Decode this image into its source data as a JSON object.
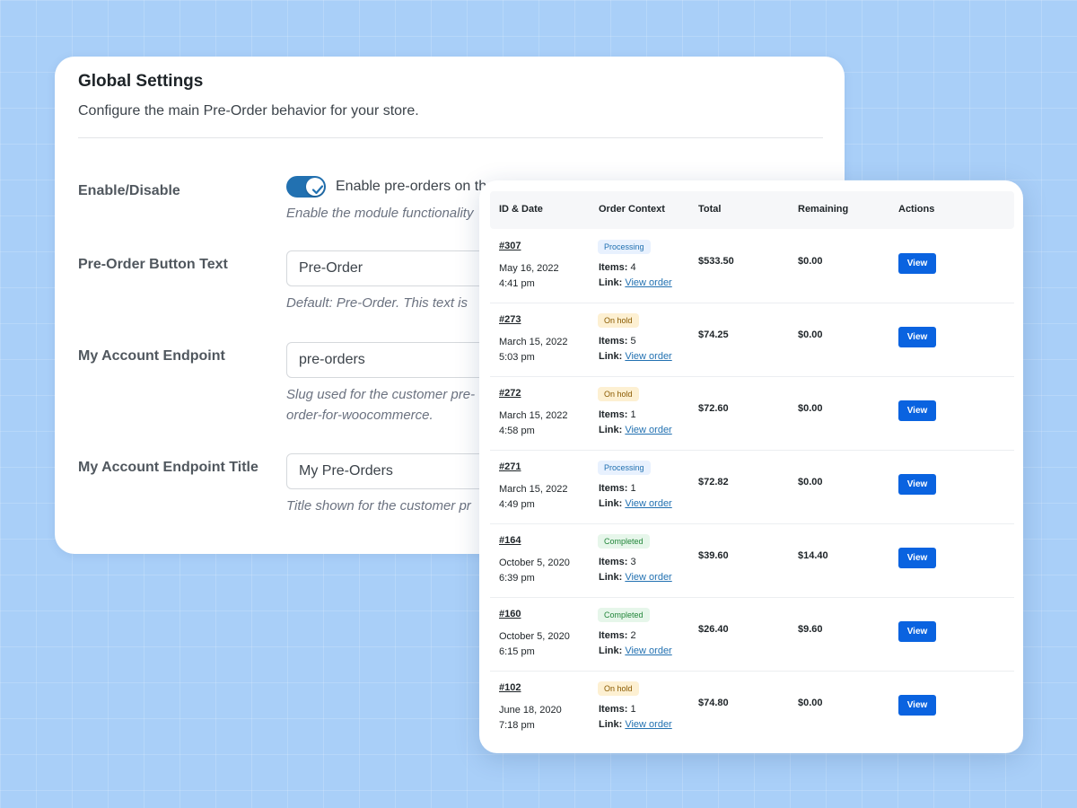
{
  "settings": {
    "title": "Global Settings",
    "subtitle": "Configure the main Pre-Order behavior for your store.",
    "enable": {
      "label": "Enable/Disable",
      "checkbox_label": "Enable pre-orders on th",
      "checked": true,
      "description": "Enable the module functionality"
    },
    "button_text": {
      "label": "Pre-Order Button Text",
      "value": "Pre-Order",
      "description": "Default: Pre-Order. This text is"
    },
    "endpoint": {
      "label": "My Account Endpoint",
      "value": "pre-orders",
      "description_line1": "Slug used for the customer pre-",
      "description_line2": "order-for-woocommerce."
    },
    "endpoint_title": {
      "label": "My Account Endpoint Title",
      "value": "My Pre-Orders",
      "description": "Title shown for the customer pr"
    }
  },
  "orders": {
    "columns": [
      "ID & Date",
      "Order Context",
      "Total",
      "Remaining",
      "Actions"
    ],
    "items_label": "Items:",
    "link_label": "Link:",
    "link_text": "View order",
    "view_label": "View",
    "rows": [
      {
        "id": "#307",
        "date": "May 16, 2022",
        "time": "4:41 pm",
        "status": "Processing",
        "items": "4",
        "total": "$533.50",
        "remaining": "$0.00"
      },
      {
        "id": "#273",
        "date": "March 15, 2022",
        "time": "5:03 pm",
        "status": "On hold",
        "items": "5",
        "total": "$74.25",
        "remaining": "$0.00"
      },
      {
        "id": "#272",
        "date": "March 15, 2022",
        "time": "4:58 pm",
        "status": "On hold",
        "items": "1",
        "total": "$72.60",
        "remaining": "$0.00"
      },
      {
        "id": "#271",
        "date": "March 15, 2022",
        "time": "4:49 pm",
        "status": "Processing",
        "items": "1",
        "total": "$72.82",
        "remaining": "$0.00"
      },
      {
        "id": "#164",
        "date": "October 5, 2020",
        "time": "6:39 pm",
        "status": "Completed",
        "items": "3",
        "total": "$39.60",
        "remaining": "$14.40"
      },
      {
        "id": "#160",
        "date": "October 5, 2020",
        "time": "6:15 pm",
        "status": "Completed",
        "items": "2",
        "total": "$26.40",
        "remaining": "$9.60"
      },
      {
        "id": "#102",
        "date": "June 18, 2020",
        "time": "7:18 pm",
        "status": "On hold",
        "items": "1",
        "total": "$74.80",
        "remaining": "$0.00"
      }
    ]
  },
  "colors": {
    "background": "#a9cff8",
    "accent": "#2271b1",
    "button": "#0a63e0"
  }
}
